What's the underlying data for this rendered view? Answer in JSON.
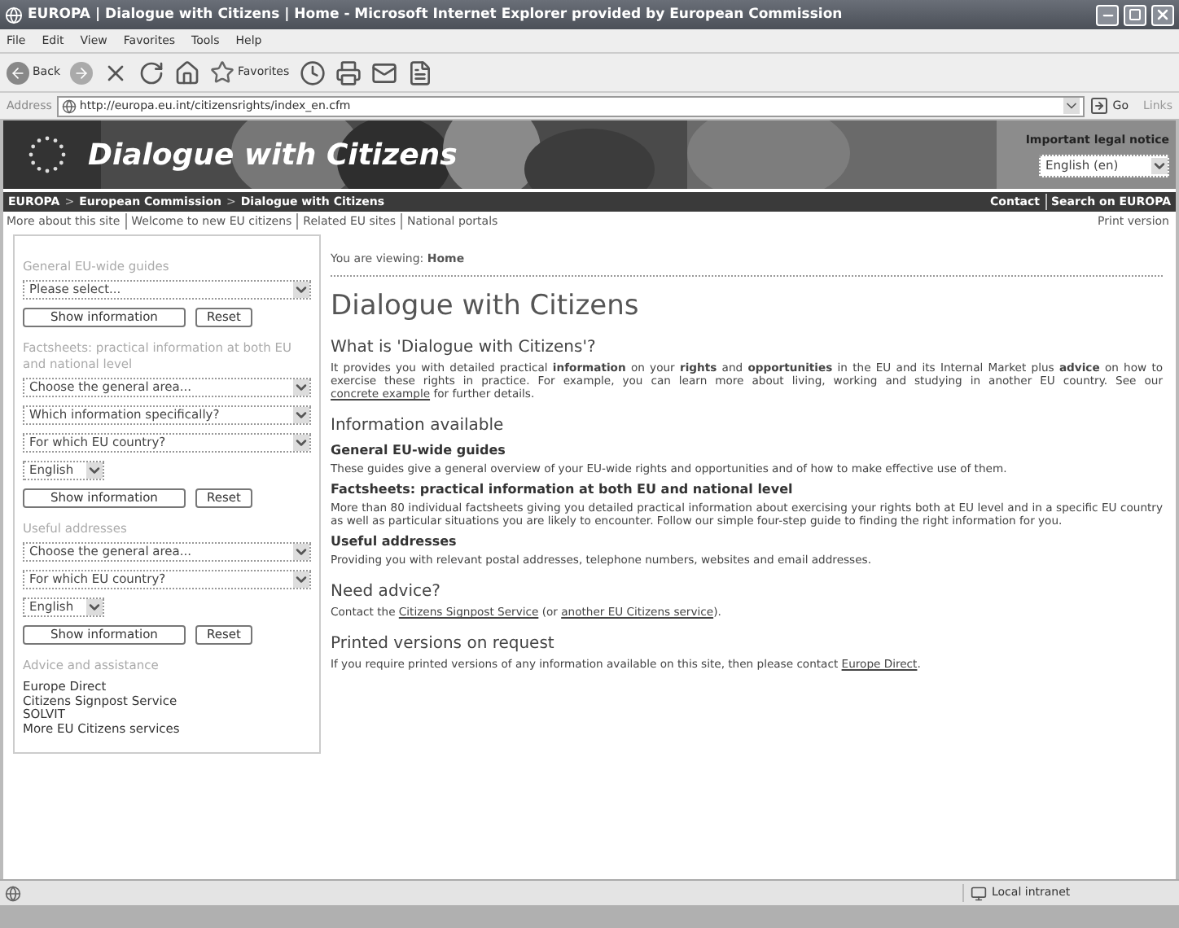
{
  "window": {
    "title": "EUROPA | Dialogue with Citizens | Home - Microsoft Internet Explorer provided by European Commission"
  },
  "menu": [
    "File",
    "Edit",
    "View",
    "Favorites",
    "Tools",
    "Help"
  ],
  "toolbar": {
    "back": "Back",
    "favorites": "Favorites"
  },
  "address": {
    "label": "Address",
    "url": "http://europa.eu.int/citizensrights/index_en.cfm",
    "go": "Go",
    "links": "Links"
  },
  "banner": {
    "title": "Dialogue with Citizens",
    "legal_notice": "Important legal notice",
    "language": "English (en)"
  },
  "breadcrumb": [
    "EUROPA",
    "European Commission",
    "Dialogue with Citizens"
  ],
  "breadcrumb_separator": ">",
  "service_links": [
    "Contact",
    "Search on EUROPA"
  ],
  "top_links": [
    "More about this site",
    "Welcome to new EU citizens",
    "Related EU sites",
    "National portals"
  ],
  "print_version": "Print version",
  "sidebar": [
    {
      "kind": "form",
      "title": "General EU-wide guides",
      "selects": [
        "Please select..."
      ],
      "buttons": [
        "Show information",
        "Reset"
      ]
    },
    {
      "kind": "form",
      "title": "Factsheets: practical information at both EU and national level",
      "selects": [
        "Choose the general area...",
        "Which information specifically?",
        "For which EU country?"
      ],
      "language": "English",
      "buttons": [
        "Show information",
        "Reset"
      ]
    },
    {
      "kind": "form",
      "title": "Useful addresses",
      "selects": [
        "Choose the general area...",
        "For which EU country?"
      ],
      "language": "English",
      "buttons": [
        "Show information",
        "Reset"
      ]
    },
    {
      "kind": "links",
      "title": "Advice and assistance",
      "links": [
        "Europe Direct",
        "Citizens Signpost Service",
        "SOLVIT",
        "More EU Citizens services"
      ]
    }
  ],
  "main": {
    "viewing_label": "You are viewing:",
    "viewing_value": "Home",
    "heading": "Dialogue with Citizens",
    "blocks": [
      {
        "kind": "h2",
        "text": "What is 'Dialogue with Citizens'?"
      },
      {
        "kind": "p",
        "parts": [
          {
            "text": "It provides you with detailed practical **information** on your **rights** and **opportunities** in the EU and its Internal Market plus **advice** on how to exercise these rights in practice. For example, you can learn more about living, working and studying in another EU country. See our "
          },
          {
            "link": "concrete example"
          },
          {
            "text": " for further details."
          }
        ]
      },
      {
        "kind": "h2",
        "text": "Information available"
      },
      {
        "kind": "h3",
        "text": "General EU-wide guides"
      },
      {
        "kind": "p",
        "parts": [
          {
            "text": "These guides give a general overview of your EU-wide rights and opportunities and of how to make effective use of them."
          }
        ]
      },
      {
        "kind": "h3",
        "text": "Factsheets: practical information at both EU and national level"
      },
      {
        "kind": "p",
        "parts": [
          {
            "text": "More than 80 individual factsheets giving you detailed practical information about exercising your rights both at EU level and in a specific EU country as well as particular situations you are likely to encounter. Follow our simple four-step guide to finding the right information for you."
          }
        ]
      },
      {
        "kind": "h3",
        "text": "Useful addresses"
      },
      {
        "kind": "p",
        "parts": [
          {
            "text": "Providing you with relevant postal addresses, telephone numbers, websites and email addresses."
          }
        ]
      },
      {
        "kind": "h2",
        "text": "Need advice?"
      },
      {
        "kind": "p",
        "parts": [
          {
            "text": "Contact the "
          },
          {
            "link": "Citizens Signpost Service"
          },
          {
            "text": " (or "
          },
          {
            "link": "another EU Citizens service"
          },
          {
            "text": ")."
          }
        ]
      },
      {
        "kind": "h2",
        "text": "Printed versions on request"
      },
      {
        "kind": "p",
        "parts": [
          {
            "text": "If you require printed versions of any information available on this site, then please contact "
          },
          {
            "link": "Europe Direct"
          },
          {
            "text": "."
          }
        ]
      }
    ]
  },
  "status_bar": {
    "zone": "Local intranet"
  }
}
